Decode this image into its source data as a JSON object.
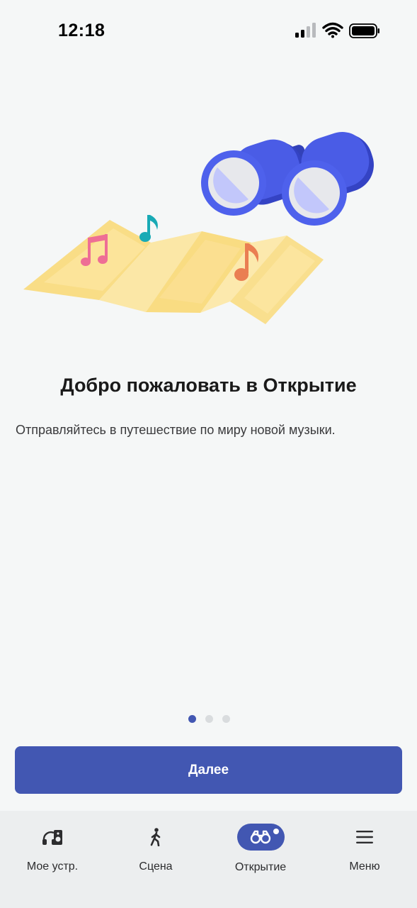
{
  "status_bar": {
    "time": "12:18",
    "icons": [
      "cellular-signal-icon",
      "wifi-icon",
      "battery-icon"
    ]
  },
  "illustration": {
    "icons": [
      "folded-map-icon",
      "binoculars-icon",
      "music-note-icon"
    ],
    "colors": {
      "map": "#fbe39a",
      "binoculars": "#4a5ce6",
      "note_pink": "#ee6e95",
      "note_teal": "#18aab5",
      "note_orange": "#ea7e52"
    }
  },
  "onboarding": {
    "title": "Добро пожаловать в Открытие",
    "subtitle": "Отправляйтесь в путешествие по миру новой музыки.",
    "pager": {
      "total": 3,
      "current": 1
    },
    "next_label": "Далее"
  },
  "tab_bar": {
    "tabs": [
      {
        "label": "Мое устр.",
        "icon": "speaker-headphones-icon",
        "active": false
      },
      {
        "label": "Сцена",
        "icon": "walking-person-icon",
        "active": false
      },
      {
        "label": "Открытие",
        "icon": "binoculars-icon",
        "active": true
      },
      {
        "label": "Меню",
        "icon": "hamburger-menu-icon",
        "active": false
      }
    ]
  },
  "colors": {
    "accent": "#4257b2",
    "background": "#f5f7f7",
    "tab_bar_background": "#eceeef",
    "inactive_dot": "#d9dcde"
  }
}
